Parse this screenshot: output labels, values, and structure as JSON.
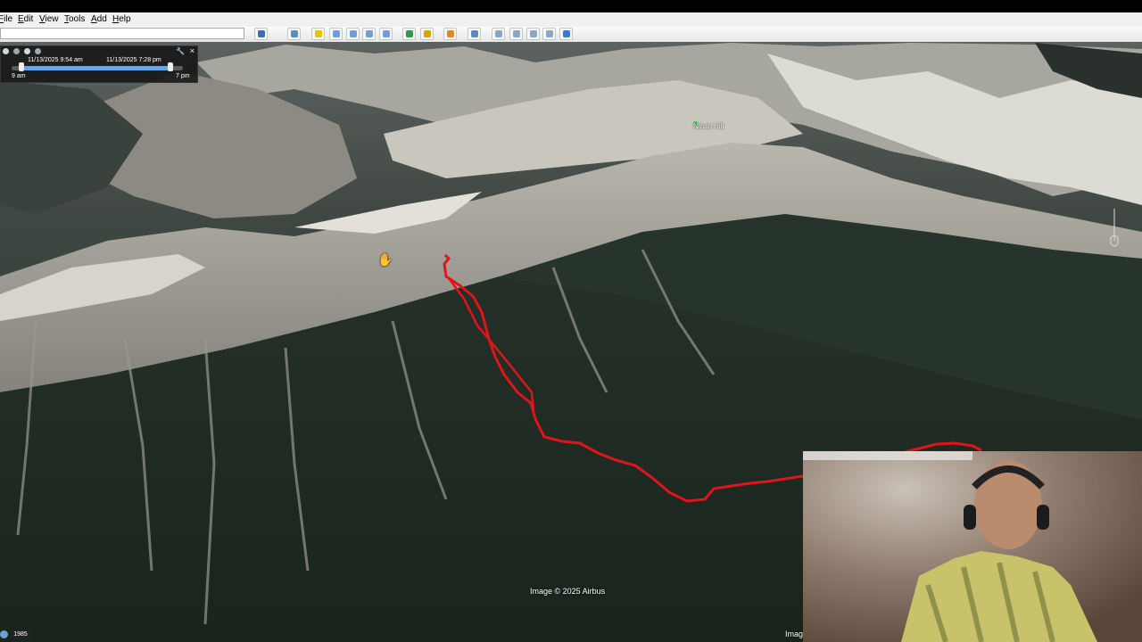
{
  "menu": {
    "items": [
      {
        "label": "File",
        "accel": "F",
        "rest": "ile"
      },
      {
        "label": "Edit",
        "accel": "E",
        "rest": "dit"
      },
      {
        "label": "View",
        "accel": "V",
        "rest": "iew"
      },
      {
        "label": "Tools",
        "accel": "T",
        "rest": "ools"
      },
      {
        "label": "Add",
        "accel": "A",
        "rest": "dd"
      },
      {
        "label": "Help",
        "accel": "H",
        "rest": "elp"
      }
    ]
  },
  "toolbar": {
    "search": {
      "value": "",
      "placeholder": ""
    },
    "buttons": [
      {
        "icon": "search-icon",
        "color": "#3a6fb0"
      },
      {
        "icon": "sidebar-icon",
        "color": "#5b8bc7"
      },
      {
        "icon": "placemark-icon",
        "color": "#e4c400"
      },
      {
        "icon": "polygon-icon",
        "color": "#6f9fd8"
      },
      {
        "icon": "path-icon",
        "color": "#6f9fd8"
      },
      {
        "icon": "overlay-icon",
        "color": "#6f9fd8"
      },
      {
        "icon": "tour-icon",
        "color": "#6f9fd8"
      },
      {
        "icon": "historical-imagery-icon",
        "color": "#2f9a4a"
      },
      {
        "icon": "sunlight-icon",
        "color": "#d8a400"
      },
      {
        "icon": "planet-icon",
        "color": "#e08a1c"
      },
      {
        "icon": "ruler-icon",
        "color": "#5b8bc7"
      },
      {
        "icon": "email-icon",
        "color": "#8aa6c8"
      },
      {
        "icon": "print-icon",
        "color": "#8aa6c8"
      },
      {
        "icon": "save-image-icon",
        "color": "#8aa6c8"
      },
      {
        "icon": "maps-icon",
        "color": "#8aa6c8"
      },
      {
        "icon": "earth-icon",
        "color": "#3a78d6"
      }
    ]
  },
  "time_slider": {
    "start_label": "11/13/2025  9:54 am",
    "end_label": "11/13/2025  7:28 pm",
    "left_tick": "9 am",
    "right_tick": "7 pm"
  },
  "map": {
    "place_label": "Ninan Hill",
    "credit": "Image © 2025 Airbus",
    "credit_partial": "Imag",
    "year_badge": "1985",
    "track_color": "#e0141c"
  }
}
